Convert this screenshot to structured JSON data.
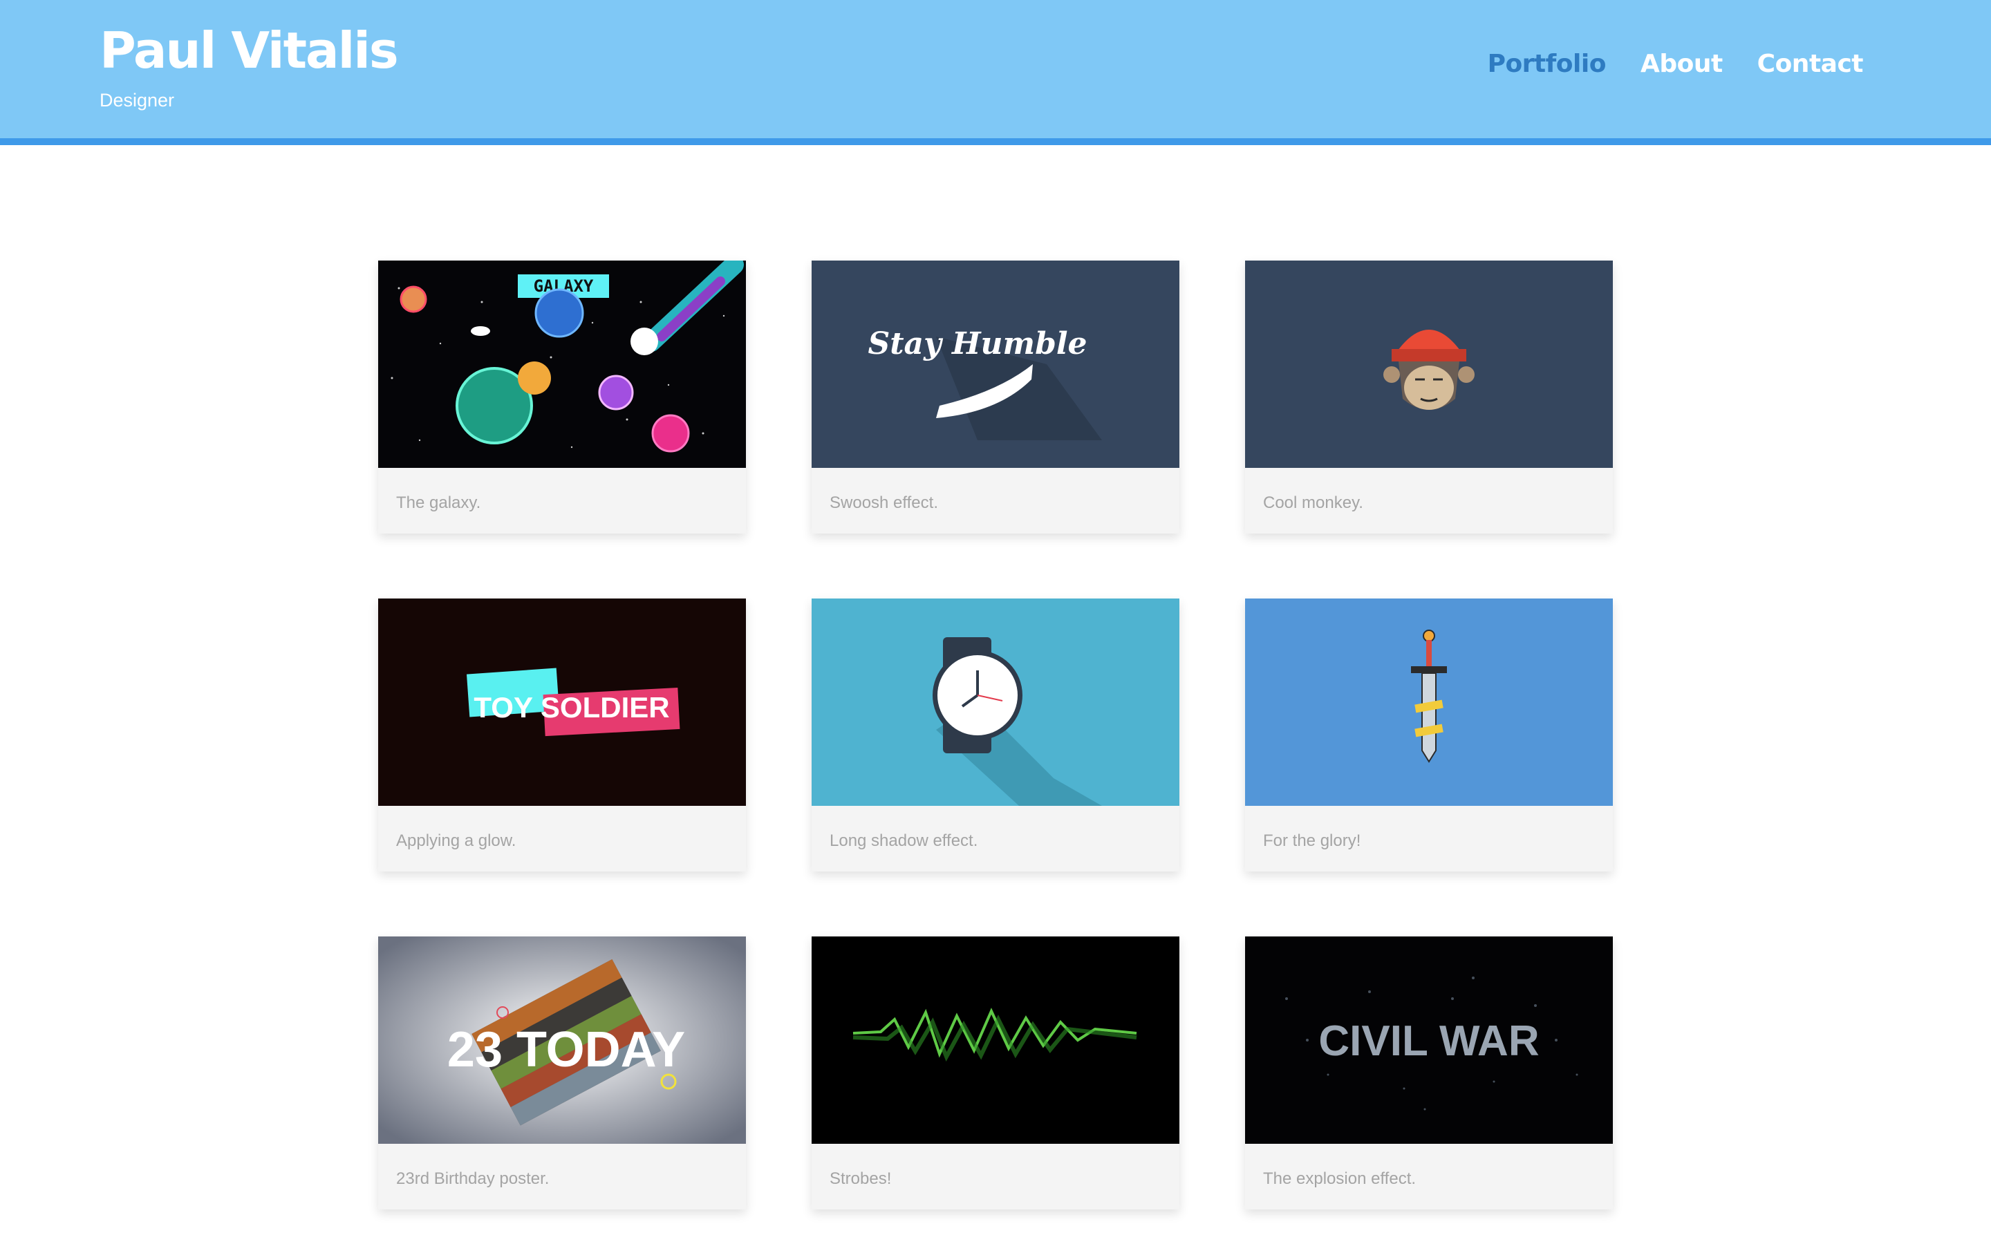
{
  "site": {
    "title": "Paul Vitalis",
    "subtitle": "Designer"
  },
  "nav": [
    {
      "label": "Portfolio",
      "active": true
    },
    {
      "label": "About",
      "active": false
    },
    {
      "label": "Contact",
      "active": false
    }
  ],
  "colors": {
    "header_bg": "#7fc8f6",
    "header_border": "#3f9ae9",
    "nav_active": "#2e7bc1",
    "card_bg": "#f4f4f4",
    "caption_text": "#a4a4a4"
  },
  "portfolio": [
    {
      "caption": "The galaxy.",
      "thumb_icon": "galaxy-artwork",
      "thumb_text": "GALAXY"
    },
    {
      "caption": "Swoosh effect.",
      "thumb_icon": "stay-humble-artwork",
      "thumb_text": "Stay Humble"
    },
    {
      "caption": "Cool monkey.",
      "thumb_icon": "monkey-artwork",
      "thumb_text": ""
    },
    {
      "caption": "Applying a glow.",
      "thumb_icon": "toy-soldier-artwork",
      "thumb_text": "TOY SOLDIER"
    },
    {
      "caption": "Long shadow effect.",
      "thumb_icon": "watch-artwork",
      "thumb_text": ""
    },
    {
      "caption": "For the glory!",
      "thumb_icon": "sword-artwork",
      "thumb_text": ""
    },
    {
      "caption": "23rd Birthday poster.",
      "thumb_icon": "birthday-poster-artwork",
      "thumb_text": "23 TODAY"
    },
    {
      "caption": "Strobes!",
      "thumb_icon": "strobes-artwork",
      "thumb_text": ""
    },
    {
      "caption": "The explosion effect.",
      "thumb_icon": "civil-war-artwork",
      "thumb_text": "CIVIL WAR"
    }
  ]
}
